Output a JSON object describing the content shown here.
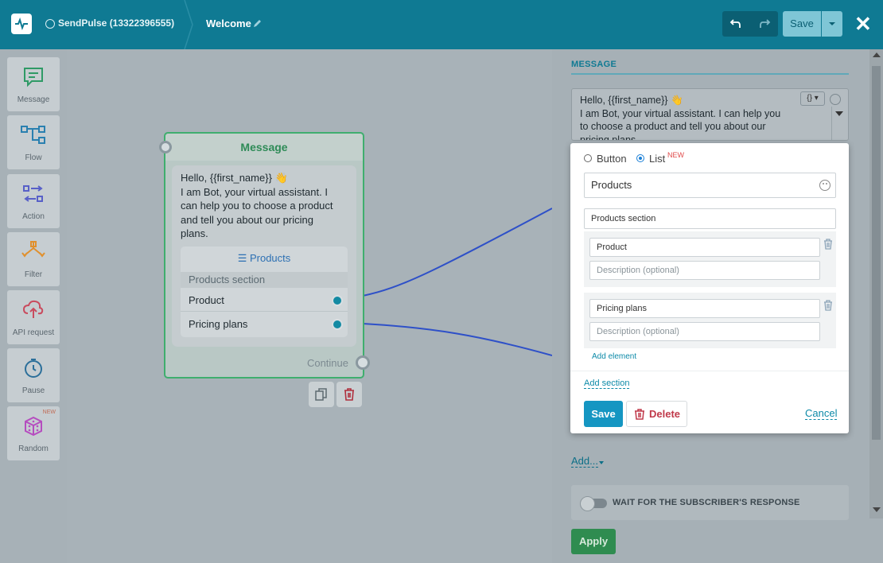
{
  "topbar": {
    "bot_name": "SendPulse (13322396555)",
    "flow_name": "Welcome",
    "save_label": "Save"
  },
  "sidebar": {
    "items": [
      {
        "label": "Message",
        "icon": "message-icon"
      },
      {
        "label": "Flow",
        "icon": "flow-icon"
      },
      {
        "label": "Action",
        "icon": "action-icon"
      },
      {
        "label": "Filter",
        "icon": "filter-icon"
      },
      {
        "label": "API request",
        "icon": "api-request-icon"
      },
      {
        "label": "Pause",
        "icon": "pause-icon"
      },
      {
        "label": "Random",
        "icon": "random-icon",
        "badge": "NEW"
      }
    ]
  },
  "node": {
    "title": "Message",
    "text_lines": [
      "Hello,  {{first_name}} 👋",
      "I am Bot, your virtual assistant. I",
      "can help you to choose a product",
      "and tell you about our pricing",
      "plans."
    ],
    "list_title": "☰ Products",
    "section": "Products section",
    "rows": [
      "Product",
      "Pricing plans"
    ],
    "continue": "Continue"
  },
  "panel": {
    "message_label": "MESSAGE",
    "textarea_lines": [
      "Hello,  {{first_name}} 👋",
      "I am Bot, your virtual assistant. I can help you",
      "to choose a product and tell you about our",
      "pricing plans."
    ],
    "var_button": "{}",
    "add_more": "Add...",
    "wait_label": "WAIT FOR THE SUBSCRIBER'S RESPONSE",
    "apply": "Apply"
  },
  "popup": {
    "radio_button": "Button",
    "radio_list": "List",
    "new_badge": "NEW",
    "list_title_value": "Products",
    "section_value": "Products section",
    "elements": [
      {
        "title": "Product",
        "desc_placeholder": "Description (optional)"
      },
      {
        "title": "Pricing plans",
        "desc_placeholder": "Description (optional)"
      }
    ],
    "add_element": "Add element",
    "add_section": "Add section",
    "save": "Save",
    "delete": "Delete",
    "cancel": "Cancel"
  },
  "colors": {
    "topbar": "#0f7a93",
    "accent": "#1596c2",
    "node_border": "#3fae6e",
    "apply": "#2f8c50",
    "delete": "#c0394a"
  }
}
